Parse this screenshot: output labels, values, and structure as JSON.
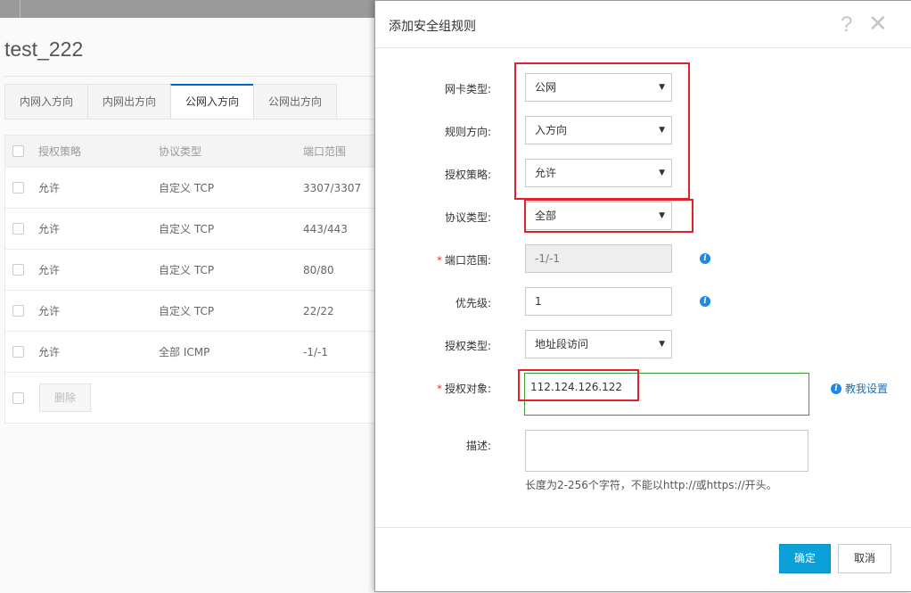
{
  "page": {
    "title": "test_222",
    "tabs": [
      {
        "label": "内网入方向"
      },
      {
        "label": "内网出方向"
      },
      {
        "label": "公网入方向"
      },
      {
        "label": "公网出方向"
      }
    ],
    "table": {
      "headers": [
        "授权策略",
        "协议类型",
        "端口范围"
      ],
      "rows": [
        {
          "policy": "允许",
          "protocol": "自定义 TCP",
          "port": "3307/3307"
        },
        {
          "policy": "允许",
          "protocol": "自定义 TCP",
          "port": "443/443"
        },
        {
          "policy": "允许",
          "protocol": "自定义 TCP",
          "port": "80/80"
        },
        {
          "policy": "允许",
          "protocol": "自定义 TCP",
          "port": "22/22"
        },
        {
          "policy": "允许",
          "protocol": "全部 ICMP",
          "port": "-1/-1"
        }
      ],
      "delete_label": "删除"
    }
  },
  "dialog": {
    "title": "添加安全组规则",
    "help_glyph": "?",
    "close_glyph": "✕",
    "fields": {
      "nic_type": {
        "label": "网卡类型:",
        "value": "公网"
      },
      "direction": {
        "label": "规则方向:",
        "value": "入方向"
      },
      "policy": {
        "label": "授权策略:",
        "value": "允许"
      },
      "protocol": {
        "label": "协议类型:",
        "value": "全部"
      },
      "port_range": {
        "label": "端口范围:",
        "value": "-1/-1",
        "required": "*"
      },
      "priority": {
        "label": "优先级:",
        "value": "1"
      },
      "auth_type": {
        "label": "授权类型:",
        "value": "地址段访问"
      },
      "auth_object": {
        "label": "授权对象:",
        "value": "112.124.126.122",
        "required": "*"
      },
      "description": {
        "label": "描述:",
        "value": ""
      }
    },
    "teach_link": "教我设置",
    "hint": "长度为2-256个字符，不能以http://或https://开头。",
    "ok_label": "确定",
    "cancel_label": "取消"
  },
  "colors": {
    "accent": "#0aa0d8",
    "annotation_red": "#e0202a",
    "annotation_green": "#3a9a3a",
    "info_blue": "#1e88e5"
  }
}
